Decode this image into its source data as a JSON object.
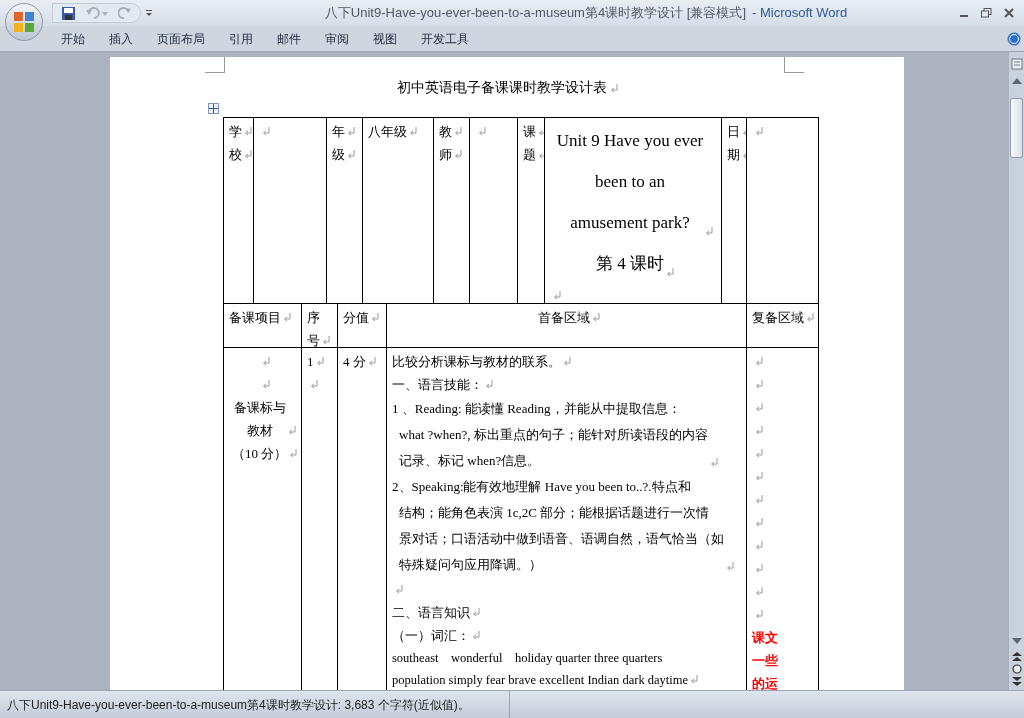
{
  "window": {
    "title": "八下Unit9-Have-you-ever-been-to-a-museum第4课时教学设计 [兼容模式]",
    "app": "- Microsoft Word"
  },
  "ribbon_tabs": [
    "开始",
    "插入",
    "页面布局",
    "引用",
    "邮件",
    "审阅",
    "视图",
    "开发工具"
  ],
  "document": {
    "heading": "初中英语电子备课课时教学设计表",
    "row_1": [
      {
        "paragraphs": [
          {
            "kind": "text",
            "lines": [
              "学"
            ]
          },
          {
            "kind": "text",
            "lines": [
              "校"
            ]
          }
        ]
      },
      {
        "paragraphs": [
          {
            "kind": "blank"
          }
        ]
      },
      {
        "paragraphs": [
          {
            "kind": "text",
            "lines": [
              "年"
            ]
          },
          {
            "kind": "text",
            "lines": [
              "级"
            ]
          }
        ]
      },
      {
        "paragraphs": [
          {
            "kind": "text",
            "lines": [
              "八年级"
            ]
          }
        ]
      },
      {
        "paragraphs": [
          {
            "kind": "text",
            "lines": [
              "教"
            ]
          },
          {
            "kind": "text",
            "lines": [
              "师"
            ]
          }
        ]
      },
      {
        "paragraphs": [
          {
            "kind": "blank"
          }
        ]
      },
      {
        "paragraphs": [
          {
            "kind": "text",
            "lines": [
              "课"
            ]
          },
          {
            "kind": "text",
            "lines": [
              "题"
            ]
          }
        ]
      },
      {
        "paragraphs": [
          {
            "kind": "topic",
            "lines": [
              "Unit 9 Have you ever",
              "been to an",
              "amusement park?"
            ]
          },
          {
            "kind": "topic",
            "lines": [
              "第 4 课时"
            ]
          },
          {
            "kind": "blank"
          }
        ]
      },
      {
        "paragraphs": [
          {
            "kind": "text",
            "lines": [
              "日"
            ]
          },
          {
            "kind": "text",
            "lines": [
              "期"
            ]
          }
        ]
      },
      {
        "paragraphs": [
          {
            "kind": "blank"
          }
        ]
      }
    ],
    "row_2": [
      {
        "paragraphs": [
          {
            "kind": "text",
            "lines": [
              "备课项目"
            ]
          }
        ]
      },
      {
        "paragraphs": [
          {
            "kind": "text",
            "lines": [
              "序",
              "号"
            ]
          }
        ]
      },
      {
        "paragraphs": [
          {
            "kind": "text",
            "lines": [
              "分值"
            ]
          }
        ]
      },
      {
        "paragraphs": [
          {
            "kind": "center",
            "lines": [
              "首备区域"
            ]
          }
        ]
      },
      {
        "paragraphs": [
          {
            "kind": "text",
            "lines": [
              "复备区域"
            ]
          }
        ]
      }
    ],
    "row_3": [
      {
        "paragraphs": [
          {
            "kind": "blank"
          },
          {
            "kind": "blank"
          },
          {
            "kind": "center",
            "lines": [
              "备课标与",
              "教材"
            ]
          },
          {
            "kind": "center",
            "lines": [
              "（10 分）"
            ]
          }
        ]
      },
      {
        "paragraphs": [
          {
            "kind": "text",
            "lines": [
              "1"
            ]
          },
          {
            "kind": "blank"
          }
        ]
      },
      {
        "paragraphs": [
          {
            "kind": "text",
            "lines": [
              "4 分"
            ]
          }
        ]
      },
      {
        "paragraphs": [
          {
            "kind": "text",
            "lines": [
              "比较分析课标与教材的联系。"
            ]
          },
          {
            "kind": "text",
            "lines": [
              "一、语言技能："
            ]
          },
          {
            "kind": "hanging",
            "lines": [
              "1 、Reading: 能读懂 Reading，并能从中提取信息：",
              "what ?when?, 标出重点的句子；能针对所读语段的内容",
              "记录、标记 when?信息。"
            ]
          },
          {
            "kind": "hanging",
            "lines": [
              "2、Speaking:能有效地理解 Have you been to..?.特点和",
              "结构；能角色表演 1c,2C 部分；能根据话题进行一次情",
              "景对话；口语活动中做到语音、语调自然，语气恰当（如",
              "特殊疑问句应用降调。）"
            ]
          },
          {
            "kind": "blank"
          },
          {
            "kind": "text",
            "lines": [
              "二、语言知识"
            ]
          },
          {
            "kind": "text",
            "lines": [
              "（一）词汇："
            ]
          },
          {
            "kind": "words",
            "lines": [
              "southeast    wonderful    holiday quarter three quarters",
              "population simply fear brave excellent Indian dark daytime"
            ]
          }
        ]
      },
      {
        "paragraphs": [
          {
            "kind": "blank"
          },
          {
            "kind": "blank"
          },
          {
            "kind": "blank"
          },
          {
            "kind": "blank"
          },
          {
            "kind": "blank"
          },
          {
            "kind": "blank"
          },
          {
            "kind": "blank"
          },
          {
            "kind": "blank"
          },
          {
            "kind": "blank"
          },
          {
            "kind": "blank"
          },
          {
            "kind": "blank"
          },
          {
            "kind": "blank"
          },
          {
            "kind": "note",
            "lines": [
              "课文",
              "一些",
              "的运"
            ]
          }
        ]
      }
    ]
  },
  "status_bar": "八下Unit9-Have-you-ever-been-to-a-museum第4课时教学设计: 3,683 个字符(近似值)。"
}
